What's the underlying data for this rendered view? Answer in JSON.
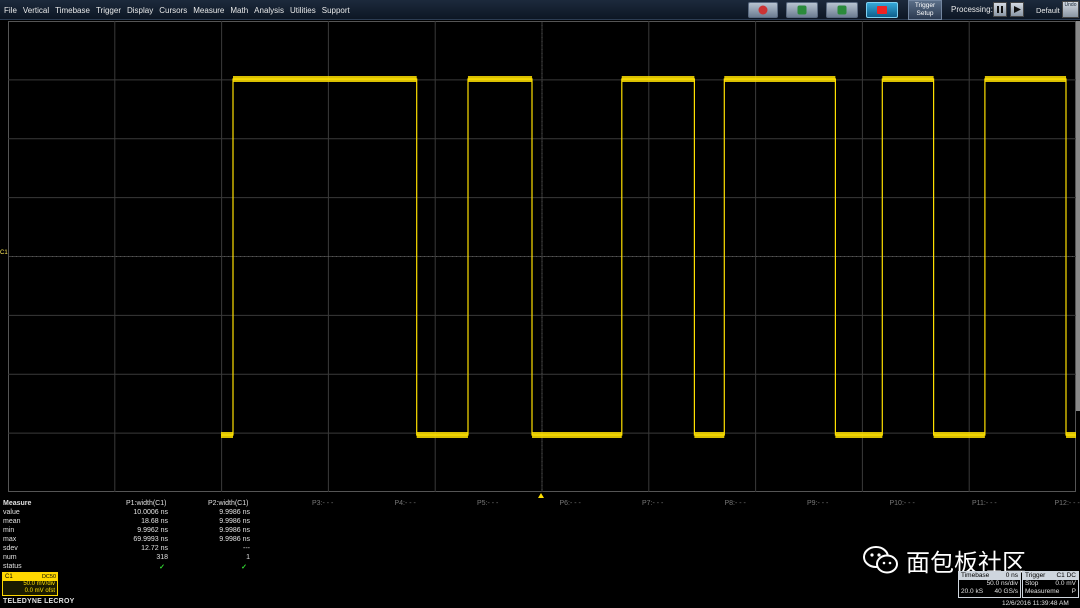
{
  "menubar": {
    "items": [
      "File",
      "Vertical",
      "Timebase",
      "Trigger",
      "Display",
      "Cursors",
      "Measure",
      "Math",
      "Analysis",
      "Utilities",
      "Support"
    ],
    "trigger_setup_line1": "Trigger",
    "trigger_setup_line2": "Setup",
    "processing_label": "Processing:",
    "default_label": "Default",
    "undo_label": "Undo"
  },
  "channel_marker": "C1",
  "measure": {
    "title": "Measure",
    "row_labels": [
      "value",
      "mean",
      "min",
      "max",
      "sdev",
      "num",
      "status"
    ],
    "params": [
      {
        "header": "P1:width(C1)",
        "values": [
          "10.0006 ns",
          "18.68 ns",
          "9.9962 ns",
          "69.9993 ns",
          "12.72 ns",
          "318"
        ],
        "status": "✓"
      },
      {
        "header": "P2:width(C1)",
        "values": [
          "9.9986 ns",
          "9.9986 ns",
          "9.9986 ns",
          "9.9986 ns",
          "---",
          "1"
        ],
        "status": "✓"
      }
    ],
    "empty_headers": [
      "P3:- - -",
      "P4:- - -",
      "P5:- - -",
      "P6:- - -",
      "P7:- - -",
      "P8:- - -",
      "P9:- - -",
      "P10:- - -",
      "P11:- - -",
      "P12:- - -"
    ]
  },
  "channel": {
    "name": "C1",
    "coupling": "DC50",
    "vdiv": "50.0 mV/div",
    "offset": "0.0 mV ofst"
  },
  "brand": "TELEDYNE LECROY",
  "timebase": {
    "title": "Timebase",
    "delay": "0 ns",
    "tdiv": "50.0 ns/div",
    "samples": "20.0 kS",
    "rate": "40 GS/s"
  },
  "trigger": {
    "title": "Trigger",
    "source": "C1 DC",
    "mode": "Stop",
    "level": "0.0 mV",
    "type": "Measureme",
    "slope": "P"
  },
  "datetime": "12/6/2016 11:39:48 AM",
  "watermark": "面包板社区",
  "colors": {
    "trace": "#ffe000",
    "grid": "#3a3a3a",
    "accent": "#ffd800"
  },
  "waveform": {
    "type": "digital",
    "start_level": "low",
    "transitions_ns": [
      0,
      43,
      55,
      70,
      91,
      108,
      115,
      141,
      152,
      164,
      176,
      195,
      236,
      260,
      275,
      288,
      295,
      310,
      318,
      320
    ]
  }
}
